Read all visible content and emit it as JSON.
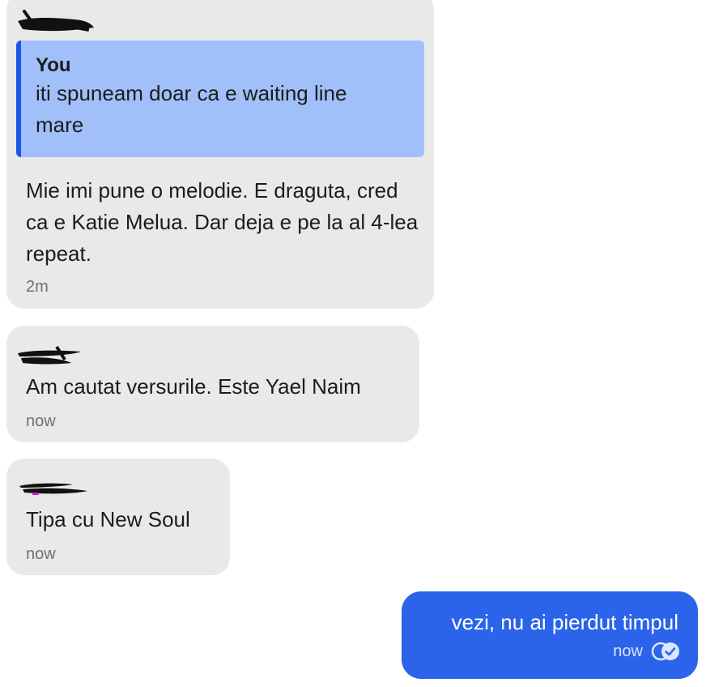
{
  "messages": [
    {
      "direction": "incoming",
      "sender_redacted": true,
      "reply_to": {
        "author": "You",
        "text": "iti spuneam doar ca e waiting line mare"
      },
      "text": "Mie imi pune o melodie. E draguta, cred ca e Katie Melua. Dar deja e pe la al 4-lea repeat.",
      "time": "2m"
    },
    {
      "direction": "incoming",
      "sender_redacted": true,
      "text": "Am cautat versurile. Este Yael Naim",
      "time": "now"
    },
    {
      "direction": "incoming",
      "sender_redacted": true,
      "text": "Tipa cu New Soul",
      "time": "now"
    },
    {
      "direction": "outgoing",
      "text": "vezi, nu ai pierdut timpul",
      "time": "now",
      "status_icon": "seen-check-icon"
    }
  ],
  "colors": {
    "incoming_bubble": "#e9e9e9",
    "outgoing_bubble": "#2b63eb",
    "quote_background": "#a1bff9",
    "quote_bar": "#1a56e8",
    "timestamp": "#707070"
  }
}
